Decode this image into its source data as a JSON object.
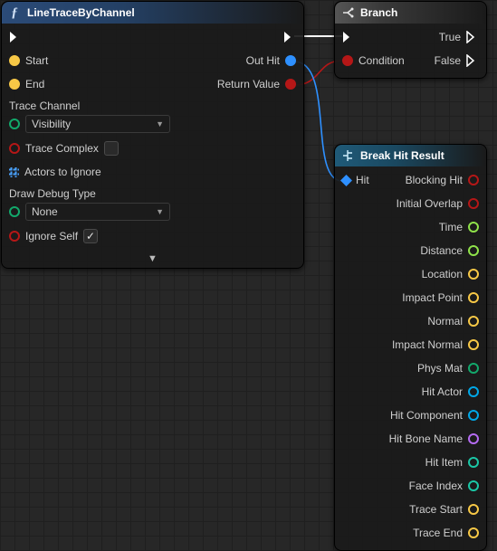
{
  "linetrace": {
    "title": "LineTraceByChannel",
    "inputs": {
      "start": "Start",
      "end": "End",
      "traceChannelLabel": "Trace Channel",
      "traceChannelValue": "Visibility",
      "traceComplex": "Trace Complex",
      "traceComplexChecked": false,
      "actorsToIgnore": "Actors to Ignore",
      "drawDebugLabel": "Draw Debug Type",
      "drawDebugValue": "None",
      "ignoreSelf": "Ignore Self",
      "ignoreSelfChecked": true
    },
    "outputs": {
      "outHit": "Out Hit",
      "returnValue": "Return Value"
    }
  },
  "branch": {
    "title": "Branch",
    "inputCondition": "Condition",
    "outputTrue": "True",
    "outputFalse": "False"
  },
  "breakhit": {
    "title": "Break Hit Result",
    "input": "Hit",
    "outputs": [
      {
        "label": "Blocking Hit",
        "cls": "c-bool"
      },
      {
        "label": "Initial Overlap",
        "cls": "c-bool"
      },
      {
        "label": "Time",
        "cls": "c-float"
      },
      {
        "label": "Distance",
        "cls": "c-float"
      },
      {
        "label": "Location",
        "cls": "c-vec"
      },
      {
        "label": "Impact Point",
        "cls": "c-vec"
      },
      {
        "label": "Normal",
        "cls": "c-vec"
      },
      {
        "label": "Impact Normal",
        "cls": "c-vec"
      },
      {
        "label": "Phys Mat",
        "cls": "c-phys"
      },
      {
        "label": "Hit Actor",
        "cls": "c-obj"
      },
      {
        "label": "Hit Component",
        "cls": "c-obj"
      },
      {
        "label": "Hit Bone Name",
        "cls": "c-name"
      },
      {
        "label": "Hit Item",
        "cls": "c-int"
      },
      {
        "label": "Face Index",
        "cls": "c-int"
      },
      {
        "label": "Trace Start",
        "cls": "c-vec"
      },
      {
        "label": "Trace End",
        "cls": "c-vec"
      }
    ]
  }
}
